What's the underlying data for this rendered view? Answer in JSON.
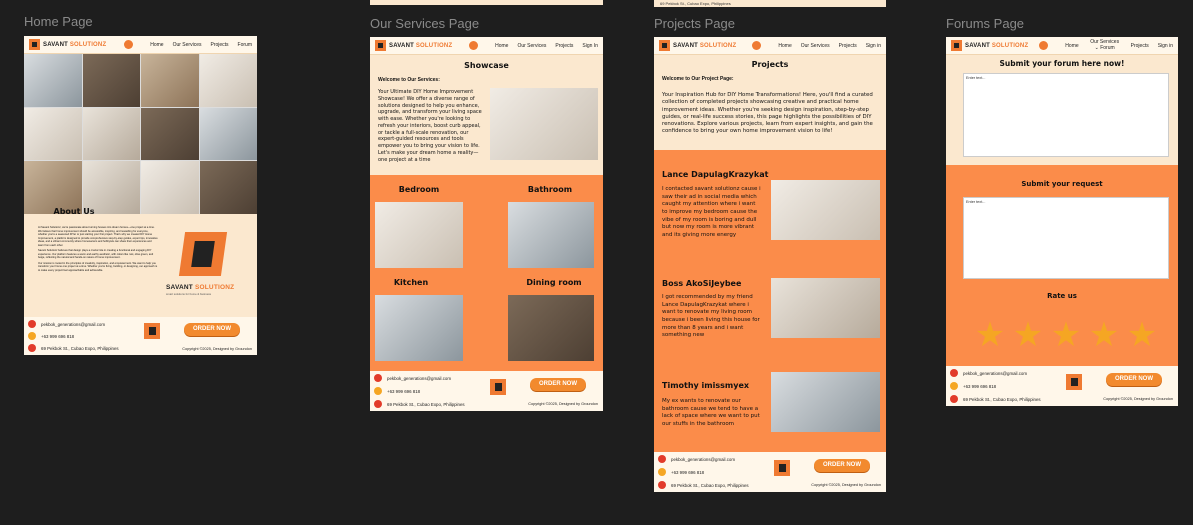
{
  "frames": {
    "home": {
      "label": "Home Page"
    },
    "services": {
      "label": "Our Services Page"
    },
    "projects": {
      "label": "Projects Page"
    },
    "forums": {
      "label": "Forums Page"
    }
  },
  "brand": {
    "name_a": "SAVANT ",
    "name_b": "SOLUTIONZ",
    "tagline": "smart solutions for home & business"
  },
  "nav": {
    "home_items": [
      "Home",
      "Our Services",
      "Projects",
      "Forum"
    ],
    "services_items": [
      "Home",
      "Our Services",
      "Projects",
      "Sign In"
    ],
    "projects_items": [
      "Home",
      "Our Services",
      "Projects",
      "Sign in"
    ],
    "forums_items": [
      "Home",
      "Our Services ⌄ Forum",
      "Projects",
      "Sign in"
    ]
  },
  "footer": {
    "email": "pekbok_generations@gmail.com",
    "phone": "+63 999 696 818",
    "address": "69 Pekbok St., Cubao Expo, Philippines",
    "order_label": "ORDER NOW",
    "copyright": "Copyright ©2025, Designed by Groundon",
    "copyright_services": "Copyright ©2025, Designed by Groundon"
  },
  "home": {
    "about_title": "About Us",
    "about_p1": "At Savant Solutionz, we're passionate about turning houses into dream homes—one project at a time. We believe that home improvement should be accessible, inspiring, and rewarding for everyone, whether you're a seasoned DIYer or just starting your first project. That's why we created DIY Home Improvement, a platform designed to provide comprehensive step-by-step guides, expert tips, innovative ideas, and a vibrant community where homeowners and hobbyists can share their experiences and learn from each other.",
    "about_p2": "Savant Solutionz believes that design plays a crucial role in creating a functional and engaging DIY experience. Our platform features a warm and earthy aesthetic, with colors like rust, olive green, and beige, reflecting the natural and hands-on nature of home improvement.",
    "about_p3": "Our mission is rooted in the principles of creativity, inspiration, and empowerment. We want to help you transform your home one project at a time. Whether you're fixing, building, or designing, our approach is to make every project feel approachable and achievable.",
    "logo_name_a": "SAVANT ",
    "logo_name_b": "SOLUTIONZ",
    "logo_tagline": "smart solutions for home & business"
  },
  "services": {
    "title": "Showcase",
    "welcome": "Welcome to Our Services:",
    "intro": "Your Ultimate DIY Home Improvement Showcase! We offer a diverse range of solutions designed to help you enhance, upgrade, and transform your living space with ease. Whether you're looking to refresh your interiors, boost curb appeal, or tackle a full-scale renovation, our expert-guided resources and tools empower you to bring your vision to life. Let's make your dream home a reality—one project at a time",
    "tiles": [
      "Bedroom",
      "Bathroom",
      "Kitchen",
      "Dining room"
    ]
  },
  "projects": {
    "title": "Projects",
    "welcome": "Welcome to Our Project Page:",
    "intro": "Your Inspiration Hub for DIY Home Transformations! Here, you'll find a curated collection of completed projects showcasing creative and practical home improvement ideas. Whether you're seeking design inspiration, step-by-step guides, or real-life success stories, this page highlights the possibilities of DIY renovations. Explore various projects, learn from expert insights, and gain the confidence to bring your own home improvement vision to life!",
    "testimonials": [
      {
        "name": "Lance DapulagKrazykat",
        "text": "I contacted savant solutionz cause i saw their ad in social media which caught my attention where i want to improve my bedroom cause the vibe of my room is boring and dull but now my room is more vibrant and its giving more energy"
      },
      {
        "name": "Boss AkoSiJeybee",
        "text": "I got recommended by my friend Lance DapulagKrazykat where i want to renovate my living room because i been living this house for more than 8 years and i want something new"
      },
      {
        "name": "Timothy imissmyex",
        "text": "My ex wants to renovate our bathroom cause we tend to have a lack of space where we want to put our stuffs in the bathroom"
      }
    ]
  },
  "forums": {
    "title": "Submit your forum here now!",
    "forum_placeholder": "Enter text...",
    "request_title": "Submit your request",
    "request_placeholder": "Enter text...",
    "rate_title": "Rate us",
    "stars": 5,
    "star_glyph": "★"
  },
  "colors": {
    "accent": "#ef7a32",
    "panel": "#fb8c4a",
    "cream": "#fbe8cf",
    "button": "#f28a2e",
    "canvas": "#1e1e1e"
  }
}
